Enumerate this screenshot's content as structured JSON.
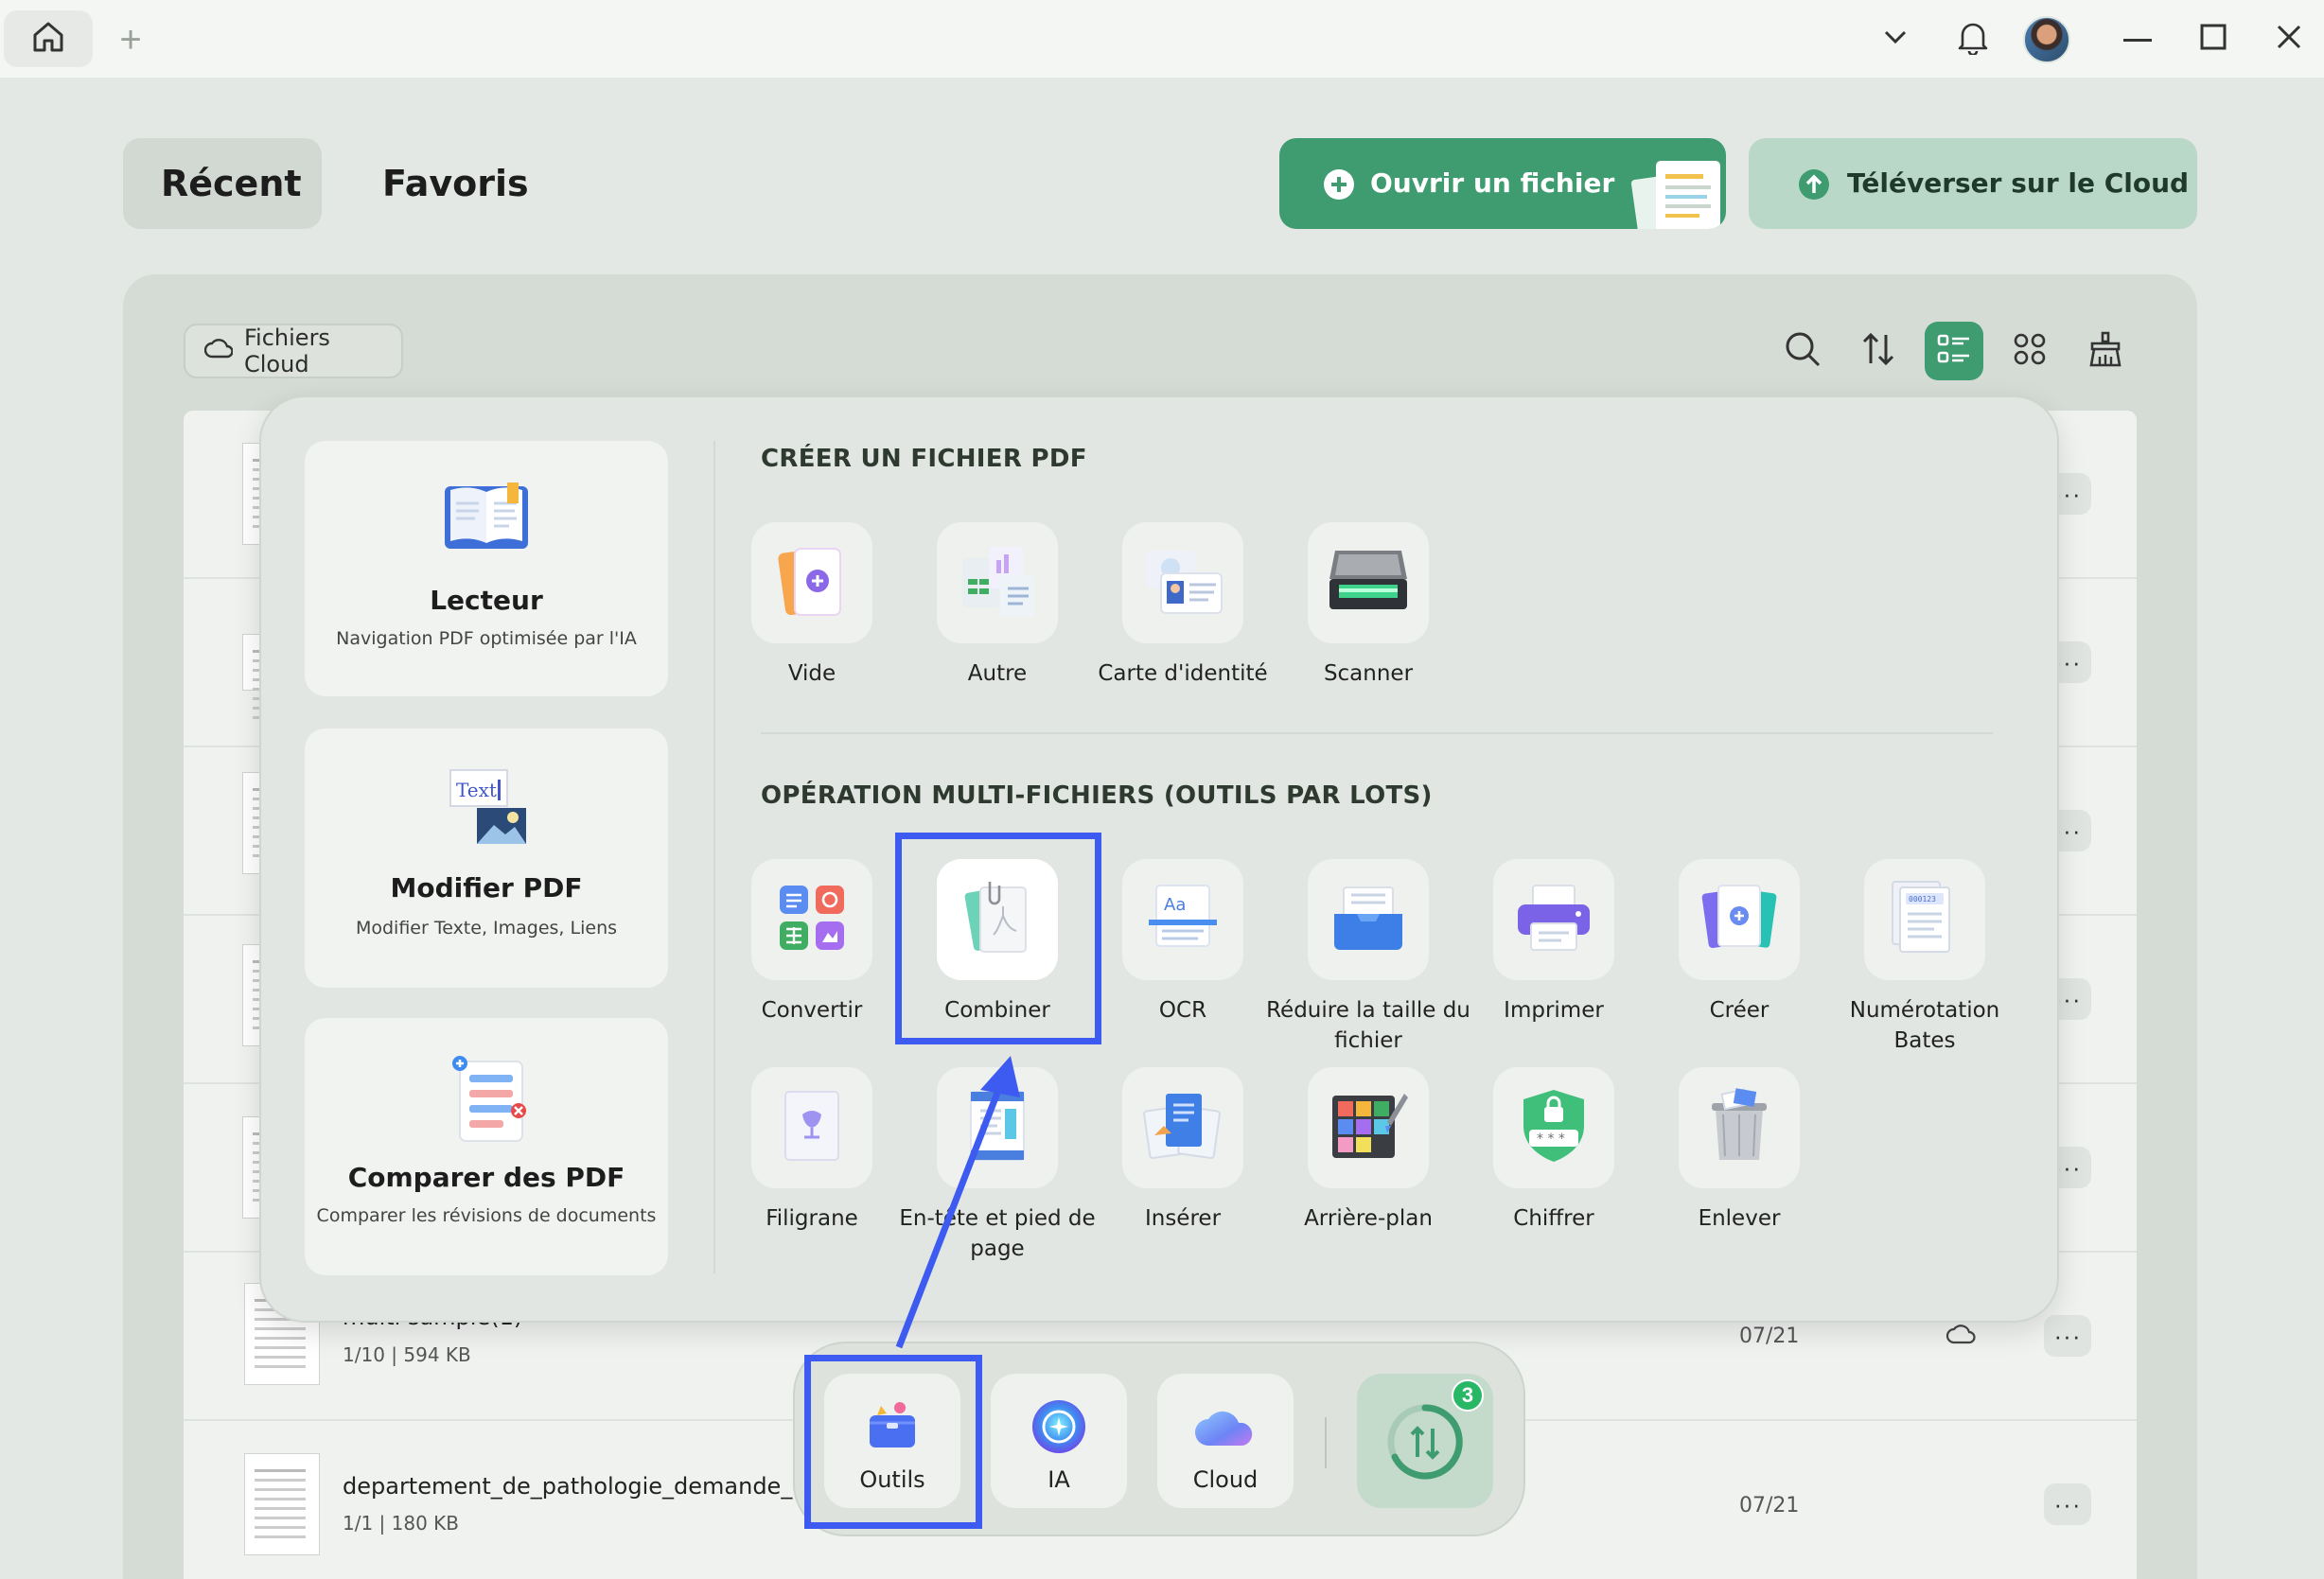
{
  "titlebar": {
    "home_icon": "home-icon",
    "new_tab_label": "+"
  },
  "nav": {
    "recent": "Récent",
    "favorites": "Favoris",
    "open_file": "Ouvrir un fichier",
    "upload_cloud": "Téléverser sur le Cloud"
  },
  "panel": {
    "cloud_files": "Fichiers Cloud"
  },
  "files": [
    {
      "title": "multi sample(1)",
      "meta": "1/10 | 594 KB",
      "date": "07/21"
    },
    {
      "title": "departement_de_pathologie_demande_analys",
      "meta": "1/1 | 180 KB",
      "date": "07/21"
    }
  ],
  "more_label": "···",
  "popup": {
    "reader": {
      "title": "Lecteur",
      "subtitle": "Navigation PDF optimisée par l'IA"
    },
    "edit": {
      "title": "Modifier PDF",
      "subtitle": "Modifier Texte, Images, Liens",
      "icon_text": "Text"
    },
    "compare": {
      "title": "Comparer des PDF",
      "subtitle": "Comparer les révisions de documents"
    },
    "create_section": "CRÉER UN FICHIER PDF",
    "create_tools": [
      "Vide",
      "Autre",
      "Carte d'identité",
      "Scanner"
    ],
    "batch_section": "OPÉRATION MULTI-FICHIERS (OUTILS PAR LOTS)",
    "batch_tools_row1": [
      "Convertir",
      "Combiner",
      "OCR",
      "Réduire la taille du fichier",
      "Imprimer",
      "Créer",
      "Numérotation Bates"
    ],
    "batch_tools_row2": [
      "Filigrane",
      "En-tête et pied de page",
      "Insérer",
      "Arrière-plan",
      "Chiffrer",
      "Enlever"
    ],
    "bates_sample": "000123"
  },
  "dock": {
    "tools": "Outils",
    "ai": "IA",
    "cloud": "Cloud",
    "sync_badge": "3"
  },
  "colors": {
    "accent_green": "#3f9b70",
    "highlight_blue": "#3d5bf0"
  }
}
